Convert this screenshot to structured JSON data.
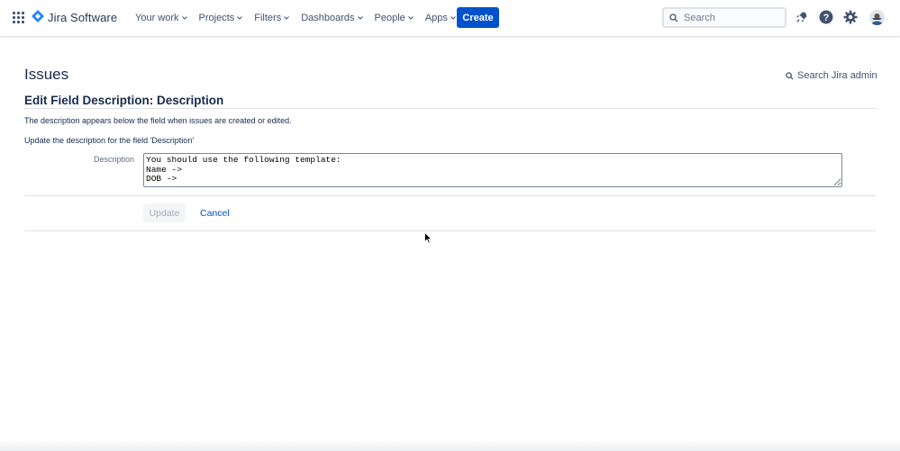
{
  "topnav": {
    "app_name": "Jira Software",
    "items": [
      {
        "label": "Your work"
      },
      {
        "label": "Projects"
      },
      {
        "label": "Filters"
      },
      {
        "label": "Dashboards"
      },
      {
        "label": "People"
      },
      {
        "label": "Apps"
      }
    ],
    "create_label": "Create",
    "search_placeholder": "Search",
    "icons": [
      "app-switcher-icon",
      "notifications-icon",
      "help-icon",
      "settings-icon"
    ],
    "brand_color": "#0052cc"
  },
  "page": {
    "title": "Issues",
    "admin_search_label": "Search Jira admin",
    "section_title": "Edit Field Description: Description",
    "intro": "The description appears below the field when issues are created or edited.",
    "instruction": "Update the description for the field 'Description'"
  },
  "form": {
    "field_label": "Description",
    "field_value": "You should use the following template:\nName ->\nDOB ->",
    "update_label": "Update",
    "cancel_label": "Cancel"
  }
}
